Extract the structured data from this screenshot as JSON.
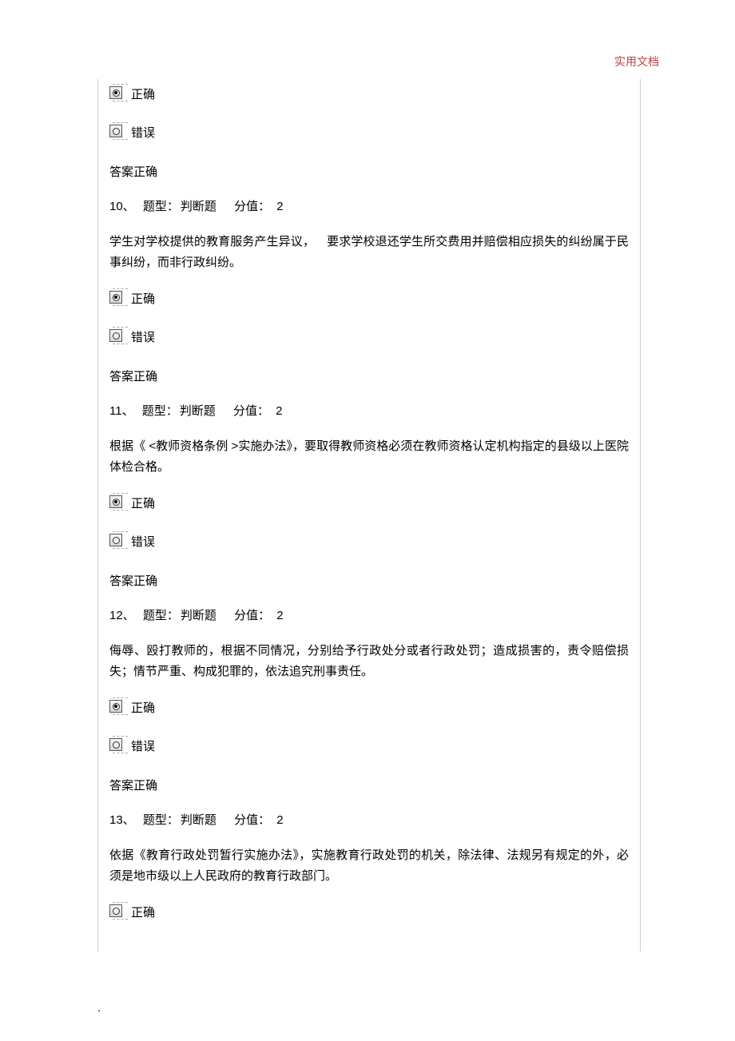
{
  "header": "实用文档",
  "labels": {
    "type_label": "题型：",
    "score_label": "分值：",
    "correct": "正确",
    "wrong": "错误",
    "answer_correct": "答案正确"
  },
  "question_type": "判断题",
  "question_score": "2",
  "q9": {
    "answer": "答案正确"
  },
  "q10": {
    "num": "10、",
    "text": "学生对学校提供的教育服务产生异议， 要求学校退还学生所交费用并赔偿相应损失的纠纷属于民事纠纷，而非行政纠纷。",
    "answer": "答案正确"
  },
  "q11": {
    "num": "11、",
    "text": "根据《 <教师资格条例 >实施办法》，要取得教师资格必须在教师资格认定机构指定的县级以上医院体检合格。",
    "answer": "答案正确"
  },
  "q12": {
    "num": "12、",
    "text": "侮辱、殴打教师的，根据不同情况，分别给予行政处分或者行政处罚；造成损害的，责令赔偿损失；情节严重、构成犯罪的，依法追究刑事责任。",
    "answer": "答案正确"
  },
  "q13": {
    "num": "13、",
    "text": "依据《教育行政处罚暂行实施办法》，实施教育行政处罚的机关，除法律、法规另有规定的外，必须是地市级以上人民政府的教育行政部门。"
  },
  "footer": "."
}
